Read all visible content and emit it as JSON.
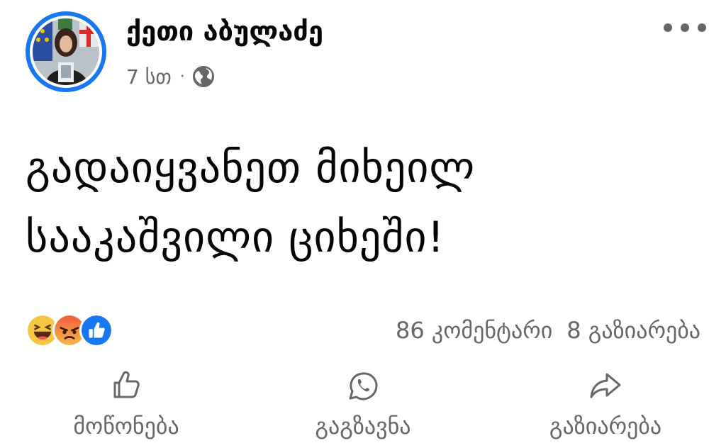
{
  "post": {
    "author_name": "ქეთი აბულაძე",
    "time": "7 სთ",
    "separator": "·",
    "privacy_icon": "globe-icon",
    "more_icon": "more-horizontal-icon",
    "text_lines": [
      "გადაიყვანეთ მიხეილ",
      "სააკაშვილი ციხეში!"
    ]
  },
  "reactions": {
    "icons": [
      "haha-reaction-icon",
      "angry-reaction-icon",
      "like-reaction-icon"
    ],
    "comments_label": "86 კომენტარი",
    "shares_label": "8 გაზიარება"
  },
  "actions": [
    {
      "icon": "like-icon",
      "label": "მოწონება"
    },
    {
      "icon": "whatsapp-icon",
      "label": "გაგზავნა"
    },
    {
      "icon": "share-icon",
      "label": "გაზიარება"
    }
  ],
  "colors": {
    "accent": "#1877f2",
    "secondary_text": "#65676b",
    "primary_text": "#050505"
  }
}
